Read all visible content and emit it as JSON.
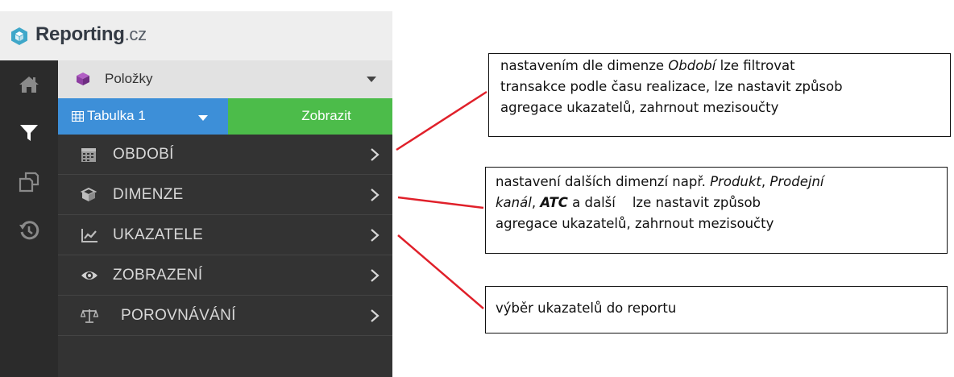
{
  "logo": {
    "brand": "Reporting",
    "tld": ".cz"
  },
  "items_selector": {
    "label": "Položky"
  },
  "table_selector": {
    "label": "Tabulka 1"
  },
  "show_button": {
    "label": "Zobrazit"
  },
  "sidebar_icons": [
    "home-icon",
    "filter-icon",
    "copy-icon",
    "history-icon"
  ],
  "menu": [
    {
      "label": "OBDOBÍ",
      "icon": "calendar-icon"
    },
    {
      "label": "DIMENZE",
      "icon": "cube-icon"
    },
    {
      "label": "UKAZATELE",
      "icon": "line-chart-icon"
    },
    {
      "label": "ZOBRAZENÍ",
      "icon": "eye-icon"
    },
    {
      "label": "POROVNÁVÁNÍ",
      "icon": "scales-icon"
    }
  ],
  "annotations": [
    {
      "line1_prefix": "nastavením dle dimenze ",
      "line1_em": "Období",
      "line1_suffix": " lze filtrovat",
      "line2": "transakce podle času realizace, lze nastavit způsob",
      "line3": "agregace ukazatelů, zahrnout mezisoučty"
    },
    {
      "line1_prefix": "nastavení dalších dimenzí např. ",
      "em_produkt": "Produkt",
      "comma1": ", ",
      "em_prodejni": "Prodejní",
      "em_kanal": "kanál",
      "comma2": ", ",
      "em_atc": "ATC",
      "line2_suffix": " a další    lze nastavit způsob",
      "line3": "agregace ukazatelů, zahrnout mezisoučty"
    },
    {
      "text": "výběr ukazatelů do reportu"
    }
  ],
  "colors": {
    "table_button": "#3d8fd8",
    "show_button": "#4cbc4a",
    "panel_bg": "#333333",
    "iconbar_bg": "#2b2b2b",
    "logo_mark": "#3fa7c9",
    "cube_purple": "#8e3fa2",
    "arrow": "#e0202a"
  }
}
